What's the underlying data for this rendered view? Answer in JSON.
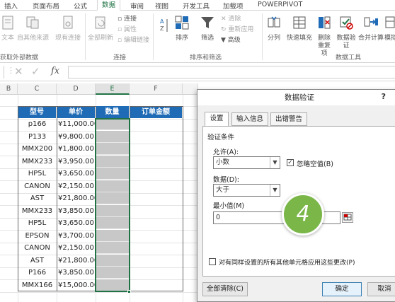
{
  "ribbon_tabs": [
    "插入",
    "页面布局",
    "公式",
    "数据",
    "审阅",
    "视图",
    "开发工具",
    "加载项",
    "POWERPIVOT"
  ],
  "active_tab": "数据",
  "ribbon": {
    "get_external": {
      "text": "文本",
      "other": "自其他来源",
      "existing": "现有连接",
      "group": "获取外部数据"
    },
    "connections": {
      "refresh_all": "全部刷新",
      "connections": "连接",
      "properties": "属性",
      "edit_links": "编辑链接",
      "group": "连接"
    },
    "sort_filter": {
      "sort": "排序",
      "filter": "筛选",
      "clear": "清除",
      "reapply": "重新应用",
      "advanced": "高级",
      "group": "排序和筛选"
    },
    "tools": {
      "split": "分列",
      "flash_fill": "快速填充",
      "remove_dup": "删除重复项",
      "validation": "数据验证",
      "consolidate": "合并计算",
      "whatif": "模拟",
      "group": "数据工具"
    }
  },
  "formula_bar": {
    "fx": "fx",
    "value": ""
  },
  "columns": [
    "B",
    "C",
    "D",
    "E",
    "F"
  ],
  "table": {
    "headers": [
      "型号",
      "单价",
      "数量",
      "订单金额"
    ],
    "rows": [
      [
        "p166",
        "¥11,000.00"
      ],
      [
        "P133",
        "¥9,800.00"
      ],
      [
        "MMX200",
        "¥1,800.00"
      ],
      [
        "MMX233",
        "¥3,950.00"
      ],
      [
        "HP5L",
        "¥3,650.00"
      ],
      [
        "CANON",
        "¥2,150.00"
      ],
      [
        "AST",
        "¥21,800.00"
      ],
      [
        "MMX233",
        "¥3,850.00"
      ],
      [
        "HP5L",
        "¥3,650.00"
      ],
      [
        "EPSON",
        "¥3,700.00"
      ],
      [
        "CANON",
        "¥2,150.00"
      ],
      [
        "AST",
        "¥21,800.00"
      ],
      [
        "P166",
        "¥3,850.00"
      ],
      [
        "MMX166",
        "¥15,000.00"
      ]
    ]
  },
  "dialog": {
    "title": "数据验证",
    "help": "?",
    "tabs": [
      "设置",
      "输入信息",
      "出错警告"
    ],
    "section": "验证条件",
    "allow_label": "允许(A):",
    "allow_value": "小数",
    "ignore_blank": "忽略空值(B)",
    "data_label": "数据(D):",
    "data_value": "大于",
    "min_label": "最小值(M)",
    "min_value": "0",
    "apply_all": "对有同样设置的所有其他单元格应用这些更改(P)",
    "clear_all": "全部清除(C)",
    "ok": "确定",
    "cancel": "取消"
  },
  "step_badge": "4"
}
